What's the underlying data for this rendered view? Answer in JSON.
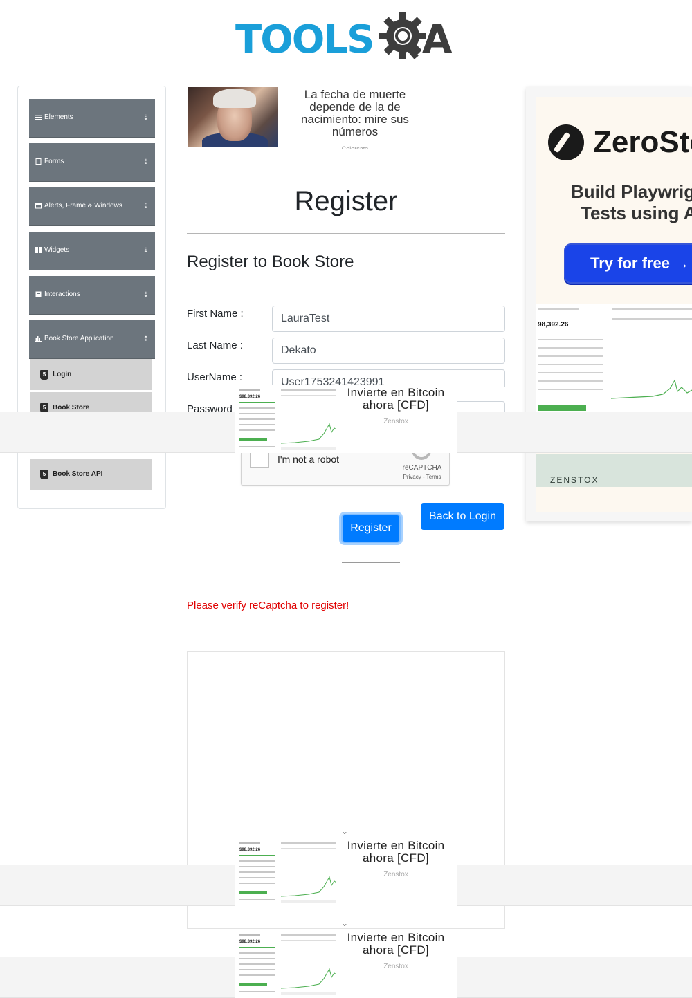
{
  "brand": {
    "name": "TOOLSQA",
    "left_text": "TOOLS",
    "right_text": "A"
  },
  "sidebar": {
    "groups": [
      {
        "label": "Elements",
        "icon": "list-icon"
      },
      {
        "label": "Forms",
        "icon": "form-icon"
      },
      {
        "label": "Alerts, Frame & Windows",
        "icon": "window-icon"
      },
      {
        "label": "Widgets",
        "icon": "grid-icon"
      },
      {
        "label": "Interactions",
        "icon": "interaction-icon"
      },
      {
        "label": "Book Store Application",
        "icon": "bar-chart-icon"
      }
    ],
    "book_store_items": [
      {
        "label": "Login"
      },
      {
        "label": "Book Store"
      },
      {
        "label": "Book Store API"
      }
    ]
  },
  "top_ad": {
    "text": "La fecha de muerte depende de la de nacimiento: mire sus números",
    "source": "Colorsata"
  },
  "form": {
    "page_title": "Register",
    "subtitle": "Register to Book Store",
    "fields": [
      {
        "label": "First Name :",
        "value": "LauraTest"
      },
      {
        "label": "Last Name :",
        "value": "Dekato"
      },
      {
        "label": "UserName :",
        "value": "User1753241423991"
      },
      {
        "label": "Password",
        "value": ""
      }
    ],
    "captcha": {
      "label": "I'm not a robot",
      "brand": "reCAPTCHA",
      "links": "Privacy - Terms"
    },
    "register_button": "Register",
    "back_button": "Back to Login",
    "error": "Please verify reCaptcha to register!"
  },
  "sticky_ads": [
    {
      "headline": "Invierte en Bitcoin ahora [CFD]",
      "sponsor": "Zenstox"
    },
    {
      "headline": "Invierte en Bitcoin ahora [CFD]",
      "sponsor": "Zenstox"
    },
    {
      "headline": "Invierte en Bitcoin ahora [CFD]",
      "sponsor": "Zenstox"
    }
  ],
  "right_ad": {
    "brand": "ZeroSte",
    "tagline_1": "Build Playwrig",
    "tagline_2": "Tests using A",
    "cta": "Try for free →",
    "screenshot_price": "98,392.26",
    "footer": "ZENSTOX"
  },
  "colors": {
    "primary": "#007bff",
    "sidebar_group": "#6c757d",
    "sidebar_item": "#d3d3d3",
    "error": "#e00000",
    "logo_blue": "#1a9fd9"
  }
}
